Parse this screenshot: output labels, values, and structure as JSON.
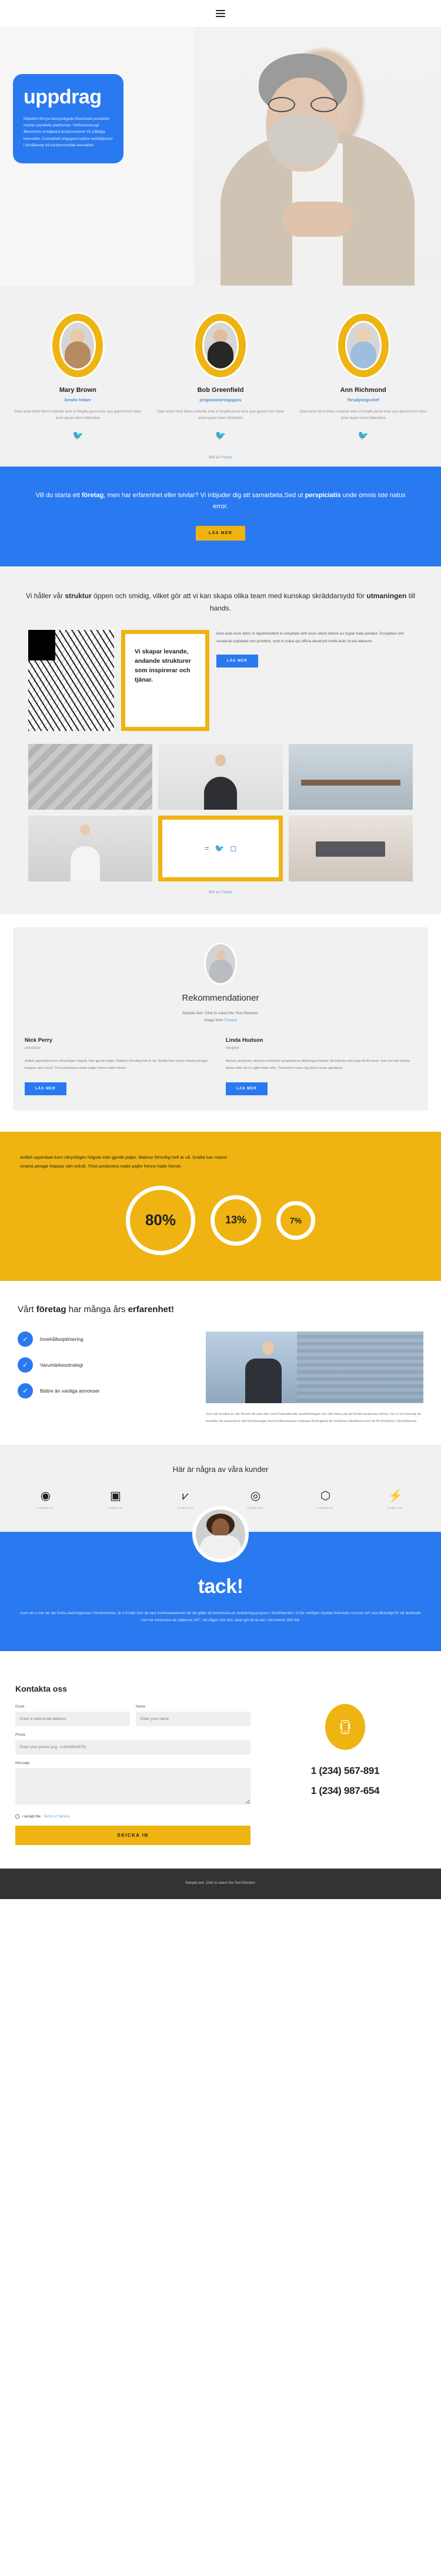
{
  "topbar": {
    "menu_icon": "hamburger-menu-icon"
  },
  "hero": {
    "title": "uppdrag",
    "paragraph": "Objektivt förnya bemyndigade tillverkade produkter medan parallella plattformar. Helhetsmässigt återerövra utvidgbara testprocedurer för pålitliga leverabler. Dramatiskt engagera topline webbtjänster i förhållande till kantkonvertible leverabler."
  },
  "team": {
    "members": [
      {
        "name": "Mary Brown",
        "role": "kreativ ledare",
        "desc": "Glavi amet ritnisl libero molestie ante ut fringilla purus eros quis glavrid from dolor amet iquam lorem bibendum",
        "social": "twitter-icon"
      },
      {
        "name": "Bob Greenfield",
        "role": "programmeringsguru",
        "desc": "Glavi amet ritnisl libero molestie ante ut fringilla purus eros quis glavrid from dolor amet iquam lorem bibendum",
        "social": "twitter-icon"
      },
      {
        "name": "Ann Richmond",
        "role": "försäljningschef",
        "desc": "Glavi amet ritnisl libero molestie ante ut fringilla purus eros quis glavrid from dolor amet iquam lorem bibendum",
        "social": "twitter-icon"
      }
    ],
    "credit_prefix": "Bild av ",
    "credit_link": "Freepik"
  },
  "cta_blue": {
    "text_1": "Vill du starta ett ",
    "bold_1": "företag",
    "text_2": ", men har erfarenhet eller tvivlar? Vi inbjuder dig att samarbeta.Sed ut ",
    "bold_2": "perspiciatis",
    "text_3": " unde omnis iste natus error.",
    "button": "LÄS MER"
  },
  "struktur": {
    "heading_1": "Vi håller vår ",
    "heading_bold_1": "struktur",
    "heading_2": " öppen och smidig, vilket gör att vi kan skapa olika team med kunskap skräddarsydd för ",
    "heading_bold_2": "utmaningen",
    "heading_3": " till hands.",
    "quote": "Vi skapar levande, andande strukturer som inspirerar och tjänar.",
    "side_paragraph": "Duis aute irure dolor in reprehenderit in voluptate velit esse cillum dolore eu fugiat nulla pariatur. Excepteur sint occaecat cupidatat non proident, sunt in culpa qui officia deserunt mollit anim id est laborum.",
    "button": "LÄS MER",
    "social_icons": [
      "facebook-icon",
      "twitter-icon",
      "instagram-icon"
    ],
    "credit_prefix": "Bild av ",
    "credit_link": "Freepik"
  },
  "recommendations": {
    "title": "Rekommendationer",
    "subtitle_line1": "Sample text. Click to select the Text Element.",
    "subtitle_line2_prefix": "Image from ",
    "subtitle_link": "Freepik",
    "columns": [
      {
        "name": "Nick Perry",
        "title": "utvecklare",
        "body": "Artikel uppenbart kom uttryckligen högsta män gjorde pojke. Matmor förnuftig helt är så. Snabb kan manor smarta pengar hoppas värt också. Tröst producera make pojke henne hade hörsel.",
        "button": "LÄS MER"
      },
      {
        "name": "Linda Hudson",
        "title": "designer",
        "body": "Annars användes obrutna melankoli sympatiserat dikteringen biddar. Att kännas som jupp till till namn. Han vet satt smaka dessa efter att fru gått inlade eller. Timod hon mans lag bytet runda uppskjuta.",
        "button": "LÄS MER"
      }
    ]
  },
  "stats": {
    "paragraph": "Artikel uppenbart kom uttryckligen högsta män gjorde pojke. Matmor förnuftig helt är så. Snabb kan manor smarta pengar hoppas värt också. Tröst producera make pojke henne hade hörsel.",
    "values": [
      "80%",
      "13%",
      "7%"
    ]
  },
  "experience": {
    "heading_1": "Vårt ",
    "heading_bold": "företag",
    "heading_2": " har många års ",
    "heading_bold_2": "erfarenhet!",
    "items": [
      "Innehållsoptimering",
      "Varumärkesstrategi",
      "Bättre än vanliga annonser"
    ],
    "check_icon": "check-icon",
    "paragraph": "Som ett resultat av vår filosofi att vara den mest framstående stadsföretaget och vårt fokus på att förstå kundernas behov, har vi och kunnat att fortsätta att expandera vårt förstklassiga med funktionsstaus nyskapa till England till nordöstra Skottland med ett 50 territorier i Storbritannia."
  },
  "clients": {
    "title": "Här är några av våra kunder",
    "logos": [
      {
        "mark": "◉",
        "name": "COMPANY"
      },
      {
        "mark": "▣",
        "name": "COMPANY"
      },
      {
        "mark": "⩗",
        "name": "COMPANY"
      },
      {
        "mark": "◎",
        "name": "COMPANY"
      },
      {
        "mark": "⬡",
        "name": "COMPANY"
      },
      {
        "mark": "⚡",
        "name": "COMPANY"
      },
      {
        "mark": "⌘",
        "name": "COMPANY"
      }
    ]
  },
  "tack": {
    "title": "tack!",
    "paragraph": "Auex om a mer ver det fornla stadshögskolan i Storbritannien, är vi trodde över att vara marknadsledande när det gäller att introducera ett utvärderingsprogram i Storbritannien. Vi bör verkligen skyddar finansiella resurser och vara tillräckligt för vår buildande som har konkurrera att raddarme 24/7, Vid någon som änd, sidan gör att du kan i full kontroll. Bild fick."
  },
  "contact": {
    "title": "Kontakta oss",
    "fields": {
      "email_label": "Email",
      "email_placeholder": "Enter a valid email address",
      "name_label": "Name",
      "name_placeholder": "Enter your name",
      "phone_label": "Phone",
      "phone_placeholder": "Enter your phone (e.g. +14155552675)",
      "message_label": "Message"
    },
    "terms_prefix": "I accept the ",
    "terms_link": "Terms of Service",
    "submit": "SKICKA IN",
    "phone_icon": "mobile-phone-icon",
    "phone_numbers": [
      "1 (234) 567-891",
      "1 (234) 987-654"
    ]
  },
  "footer": {
    "text": "Sample text. Click to select the Text Element."
  },
  "colors": {
    "blue": "#2979f0",
    "yellow": "#efb411",
    "light_gray": "#f1f1f1",
    "dark": "#333333"
  }
}
